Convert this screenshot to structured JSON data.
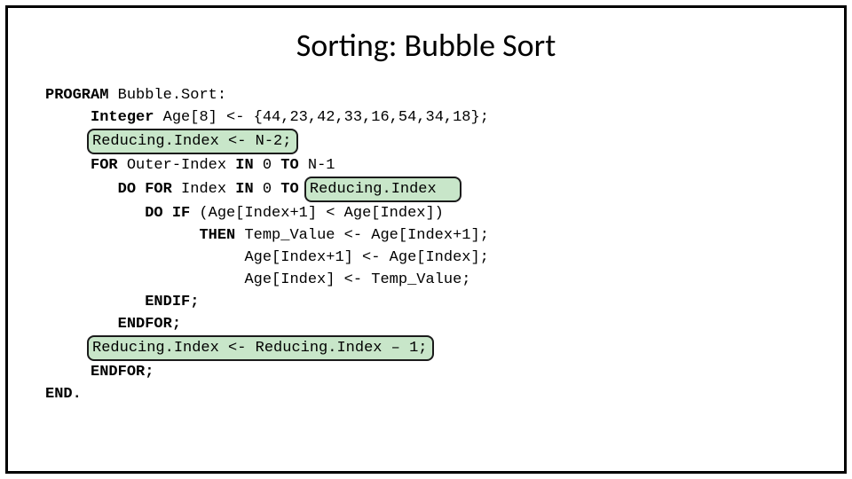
{
  "title": "Sorting: Bubble Sort",
  "code": {
    "l1a": "PROGRAM",
    "l1b": " Bubble.Sort:",
    "l2a": "Integer",
    "l2b": " Age[8] <- {44,23,42,33,16,54,34,18};",
    "l3": "Reducing.Index <- N-2;",
    "l4a": "FOR",
    "l4b": " Outer-Index ",
    "l4c": "IN",
    "l4d": " 0 ",
    "l4e": "TO",
    "l4f": " N-1",
    "l5a": "DO FOR",
    "l5b": " Index ",
    "l5c": "IN",
    "l5d": " 0 ",
    "l5e": "TO",
    "l5f": " ",
    "l5h": "Reducing.Index",
    "l6a": "DO IF",
    "l6b": " (Age[Index+1] < Age[Index])",
    "l7a": "THEN",
    "l7b": " Temp_Value <- Age[Index+1];",
    "l8": "Age[Index+1] <- Age[Index];",
    "l9": "Age[Index] <- Temp_Value;",
    "l10": "ENDIF;",
    "l11": "ENDFOR;",
    "l12": "Reducing.Index <- Reducing.Index – 1;",
    "l13": "ENDFOR;",
    "l14": "END."
  }
}
